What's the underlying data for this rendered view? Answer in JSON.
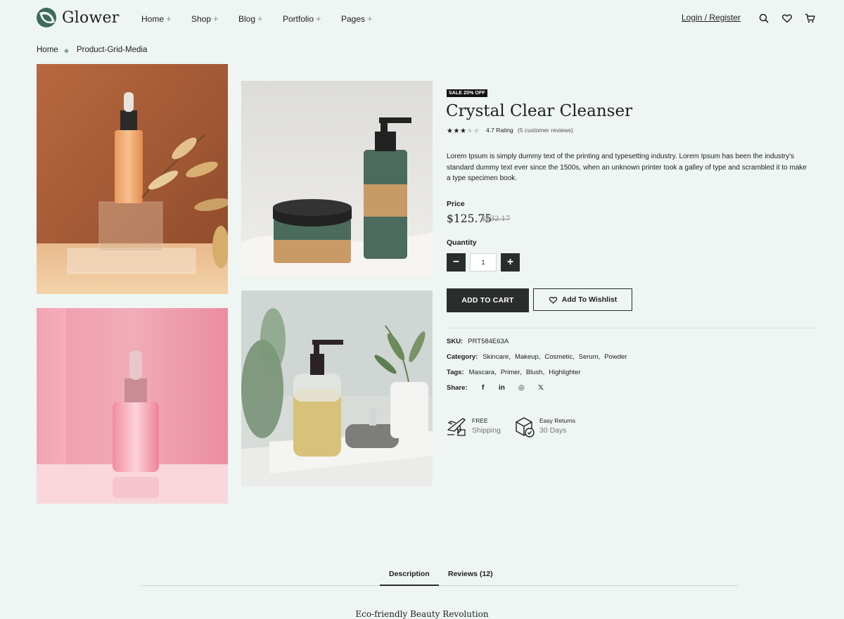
{
  "header": {
    "logo_text": "Glower",
    "nav": [
      {
        "label": "Home"
      },
      {
        "label": "Shop"
      },
      {
        "label": "Blog"
      },
      {
        "label": "Portfolio"
      },
      {
        "label": "Pages"
      }
    ],
    "nav_plus": "+",
    "login_label": "Login / Register",
    "icons": [
      "search-icon",
      "heart-icon",
      "cart-icon"
    ]
  },
  "breadcrumb": {
    "home": "Home",
    "current": "Product-Grid-Media"
  },
  "product": {
    "badge": "SALE 20% OFF",
    "title": "Crystal Clear Cleanser",
    "rating_value": 3,
    "rating_max": 5,
    "rating_text": "4.7 Rating",
    "reviews_text": "(5 customer reviews)",
    "description": "Lorem Ipsum is simply dummy text of the printing and typesetting industry. Lorem Ipsum has been the industry's standard dummy text ever since the 1500s, when an unknown printer took a galley of type and scrambled it to make a type specimen book.",
    "price_label": "Price",
    "price": "$125.75",
    "old_price": "$132.17",
    "quantity_label": "Quantity",
    "quantity_value": "1",
    "minus": "−",
    "plus": "+",
    "add_to_cart": "ADD TO CART",
    "add_to_wishlist": "Add To Wishlist",
    "sku_label": "SKU:",
    "sku": "PRT584E63A",
    "category_label": "Category:",
    "categories": [
      "Skincare,",
      "Makeup,",
      "Cosmetic,",
      "Serum,",
      "Powder"
    ],
    "tags_label": "Tags:",
    "tags": [
      "Mascara,",
      "Primer,",
      "Blush,",
      "Highlighter"
    ],
    "share_label": "Share:",
    "share_icons": {
      "facebook": "f",
      "linkedin": "in",
      "instagram": "◎",
      "x": "𝕏"
    }
  },
  "features": [
    {
      "line1": "FREE",
      "line2": "Shipping",
      "icon": "plane-box-icon"
    },
    {
      "line1": "Easy Returns",
      "line2": "30 Days",
      "icon": "return-box-icon"
    }
  ],
  "tabs": [
    {
      "label": "Description",
      "active": true
    },
    {
      "label": "Reviews (12)",
      "active": false
    }
  ],
  "section_heading": "Eco-friendly Beauty Revolution",
  "colors": {
    "background": "#eef5f2",
    "dark_button": "#2a2d2c",
    "brand": "#3e6b5a"
  }
}
